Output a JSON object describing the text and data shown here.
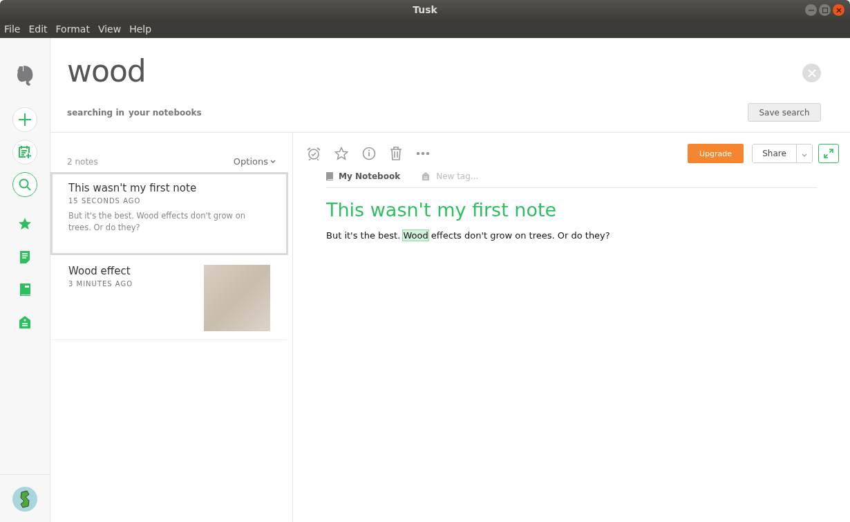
{
  "window": {
    "title": "Tusk"
  },
  "menu": [
    "File",
    "Edit",
    "Format",
    "View",
    "Help"
  ],
  "sidebar": {
    "items": [
      {
        "kind": "new-note"
      },
      {
        "kind": "new-notebook"
      },
      {
        "kind": "search",
        "selected": true
      },
      {
        "kind": "shortcuts"
      },
      {
        "kind": "notes"
      },
      {
        "kind": "notebooks"
      },
      {
        "kind": "tags"
      }
    ]
  },
  "search": {
    "query": "wood",
    "scope_label": "searching in",
    "scope": "your notebooks",
    "save_button": "Save search"
  },
  "note_list": {
    "count": "2 notes",
    "options": "Options",
    "notes": [
      {
        "title": "This wasn't my first note",
        "time": "15 SECONDS AGO",
        "snippet": "But it's the best. Wood effects don't grow on trees. Or do they?",
        "selected": true,
        "thumbnail": false
      },
      {
        "title": "Wood effect",
        "time": "3 MINUTES AGO",
        "selected": false,
        "thumbnail": true
      }
    ]
  },
  "editor": {
    "upgrade": "Upgrade",
    "share": "Share",
    "notebook": "My Notebook",
    "tag_placeholder": "New tag...",
    "title": "This wasn't my first note",
    "body": [
      {
        "text": "But it's the best. ",
        "highlighted": false
      },
      {
        "text": "Wood",
        "highlighted": true
      },
      {
        "text": " effects don't grow on trees. Or do they?",
        "highlighted": false
      }
    ]
  }
}
